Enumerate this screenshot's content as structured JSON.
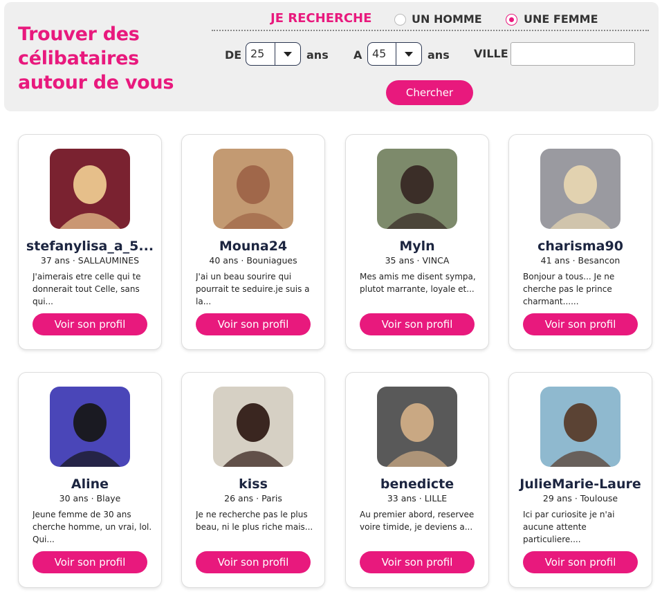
{
  "search": {
    "headline": "Trouver des célibataires autour de vous",
    "looking_for_label": "JE RECHERCHE",
    "option_man": "UN HOMME",
    "option_woman": "UNE FEMME",
    "selected_option": "UNE FEMME",
    "age_from_label": "DE",
    "age_from_value": "25",
    "age_unit": "ans",
    "age_to_label": "A",
    "age_to_value": "45",
    "city_label": "VILLE",
    "city_value": "",
    "search_button": "Chercher"
  },
  "colors": {
    "accent": "#e8197d",
    "name": "#1c2540",
    "panel": "#efefef"
  },
  "profile_button_label": "Voir son profil",
  "profiles": [
    {
      "name": "stefanylisa_a_5...",
      "meta": "37 ans · SALLAUMINES",
      "desc": "J'aimerais etre celle qui te donnerait tout Celle, sans qui...",
      "photo_bg": "#7a2230",
      "photo_fg": "#e6bf8a"
    },
    {
      "name": "Mouna24",
      "meta": "40 ans · Bouniagues",
      "desc": "J'ai un beau sourire qui pourrait te seduire.je suis a la...",
      "photo_bg": "#c39a72",
      "photo_fg": "#a0674a"
    },
    {
      "name": "Myln",
      "meta": "35 ans · VINCA",
      "desc": "Mes amis me disent sympa, plutot marrante, loyale et...",
      "photo_bg": "#7d8a6b",
      "photo_fg": "#3b2e28"
    },
    {
      "name": "charisma90",
      "meta": "41 ans · Besancon",
      "desc": "Bonjour a tous... Je ne cherche pas le prince charmant......",
      "photo_bg": "#9a9aa0",
      "photo_fg": "#e2d2b0"
    },
    {
      "name": "Aline",
      "meta": "30 ans · Blaye",
      "desc": "Jeune femme de 30 ans cherche homme, un vrai, lol. Qui...",
      "photo_bg": "#4a46b8",
      "photo_fg": "#1a1a22"
    },
    {
      "name": "kiss",
      "meta": "26 ans · Paris",
      "desc": "Je ne recherche pas le plus beau, ni le plus riche mais...",
      "photo_bg": "#d6d0c4",
      "photo_fg": "#3a2620"
    },
    {
      "name": "benedicte",
      "meta": "33 ans · LILLE",
      "desc": "Au premier abord, reservee voire timide, je deviens a...",
      "photo_bg": "#595959",
      "photo_fg": "#c9a883"
    },
    {
      "name": "JulieMarie-Laure",
      "meta": "29 ans · Toulouse",
      "desc": "Ici par curiosite je n'ai aucune attente particuliere....",
      "photo_bg": "#8fb9cf",
      "photo_fg": "#5b4334"
    }
  ]
}
